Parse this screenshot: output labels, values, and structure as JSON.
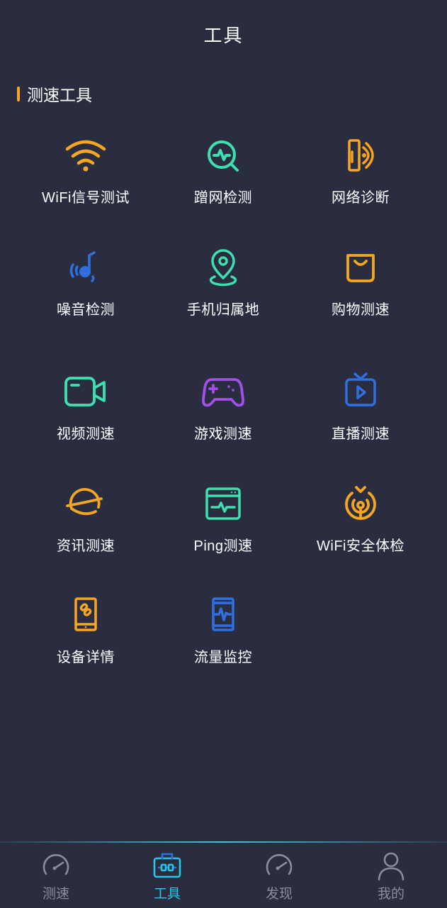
{
  "header": {
    "title": "工具"
  },
  "section": {
    "title": "测速工具"
  },
  "tools": [
    {
      "label": "WiFi信号测试",
      "icon": "wifi-icon",
      "color": "#f5a623"
    },
    {
      "label": "蹭网检测",
      "icon": "network-scan-icon",
      "color": "#3ee0b0"
    },
    {
      "label": "网络诊断",
      "icon": "network-diagnosis-icon",
      "color": "#f5a623"
    },
    {
      "label": "噪音检测",
      "icon": "noise-icon",
      "color": "#2f6fe0"
    },
    {
      "label": "手机归属地",
      "icon": "location-pin-icon",
      "color": "#3ee0b0"
    },
    {
      "label": "购物测速",
      "icon": "shopping-bag-icon",
      "color": "#f5a623"
    },
    {
      "label": "视频测速",
      "icon": "video-camera-icon",
      "color": "#3ee0b0"
    },
    {
      "label": "游戏测速",
      "icon": "gamepad-icon",
      "color": "#a34fe8"
    },
    {
      "label": "直播测速",
      "icon": "tv-play-icon",
      "color": "#2f6fe0"
    },
    {
      "label": "资讯测速",
      "icon": "planet-icon",
      "color": "#f5a623"
    },
    {
      "label": "Ping测速",
      "icon": "ping-browser-icon",
      "color": "#3ee0b0"
    },
    {
      "label": "WiFi安全体检",
      "icon": "wifi-security-icon",
      "color": "#f5a623"
    },
    {
      "label": "设备详情",
      "icon": "device-link-icon",
      "color": "#f5a623"
    },
    {
      "label": "流量监控",
      "icon": "traffic-monitor-icon",
      "color": "#2f6fe0"
    }
  ],
  "tabbar": {
    "items": [
      {
        "label": "测速",
        "icon": "speedometer-icon",
        "active": false
      },
      {
        "label": "工具",
        "icon": "toolbox-icon",
        "active": true
      },
      {
        "label": "发现",
        "icon": "discover-gauge-icon",
        "active": false
      },
      {
        "label": "我的",
        "icon": "user-icon",
        "active": false
      }
    ]
  }
}
